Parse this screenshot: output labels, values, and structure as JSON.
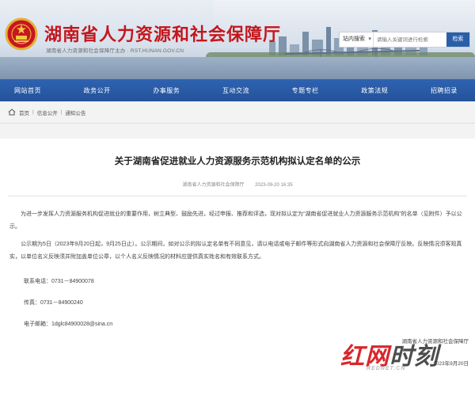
{
  "header": {
    "title": "湖南省人力资源和社会保障厅",
    "subtitle": "湖南省人力资源和社会保障厅主办 · RST.HUNAN.GOV.CN",
    "search": {
      "scope": "站内搜索",
      "placeholder": "请输入关键词进行检索",
      "button": "检索"
    }
  },
  "nav": {
    "items": [
      "网站首页",
      "政务公开",
      "办事服务",
      "互动交流",
      "专题专栏",
      "政策法规",
      "招聘招录"
    ]
  },
  "breadcrumb": {
    "items": [
      "首页",
      "信息公开",
      "通知公告"
    ]
  },
  "article": {
    "title": "关于湖南省促进就业人力资源服务示范机构拟认定名单的公示",
    "source": "湖南省人力资源和社会保障厅",
    "date": "2023-09-20 16:35",
    "paragraphs": [
      "为进一步发挥人力资源服务机构促进就业的重要作用，树立典型、鼓励先进，经过申报、推荐和评选，现对拟认定为“湖南省促进就业人力资源服务示范机构”的名单（见附件）予以公示。",
      "公示期为5日（2023年9月20日起，9月25日止）。公示期间，如对公示的拟认定名单有不同意见，请以电话或电子邮件等形式向湖南省人力资源和社会保障厅反映。反映情况须客观真实，以单位名义反映须并附加盖单位公章，以个人名义反映情况的材料应提供真实姓名和有效联系方式。"
    ],
    "contacts": {
      "tel": "联系电话：0731－84900078",
      "fax": "传真：0731－84900240",
      "email": "电子邮箱：1dglc84900028@sina.cn"
    },
    "sign_org": "湖南省人力资源和社会保障厅",
    "sign_date": "2023年9月20日"
  },
  "watermark": {
    "text_red": "红网",
    "text_dark": "时刻",
    "sub": "REDNET.CN"
  },
  "colors": {
    "brand_red": "#c4161c",
    "nav_blue": "#2a5fa8"
  }
}
